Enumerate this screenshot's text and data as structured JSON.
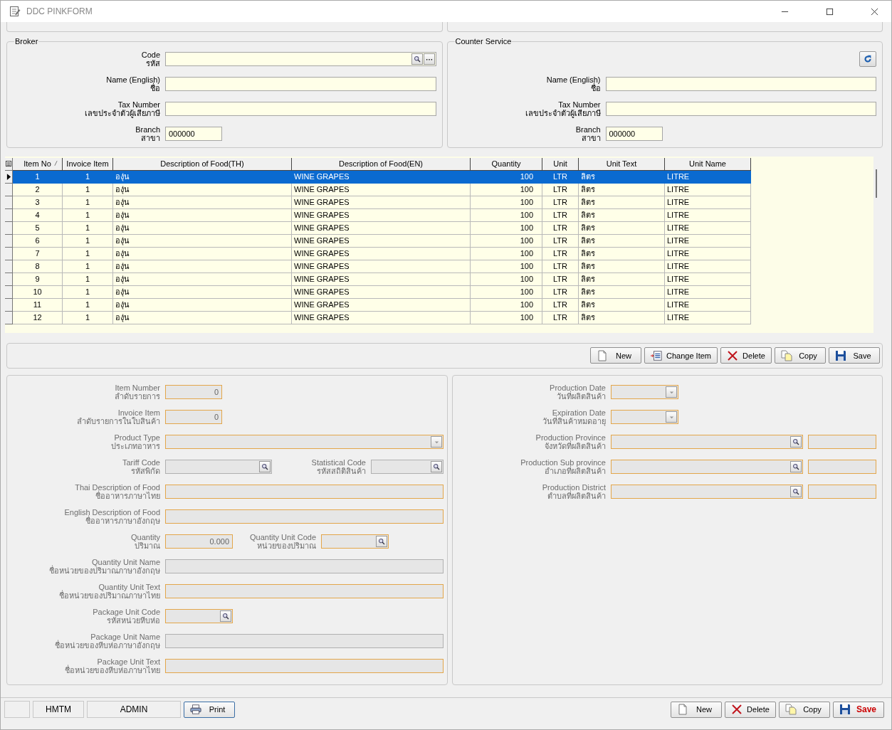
{
  "window": {
    "title": "DDC PINKFORM"
  },
  "broker": {
    "title": "Broker",
    "fields": [
      {
        "label": "Code",
        "label_th": "รหัส",
        "kind": "lookup"
      },
      {
        "label": "Name (English)",
        "label_th": "ชื่อ",
        "kind": "text"
      },
      {
        "label": "Tax Number",
        "label_th": "เลขประจำตัวผู้เสียภาษี",
        "kind": "text"
      },
      {
        "label": "Branch",
        "label_th": "สาขา",
        "kind": "text",
        "value": "000000"
      }
    ]
  },
  "counter_service": {
    "title": "Counter Service",
    "fields": [
      {
        "label": "Name (English)",
        "label_th": "ชื่อ",
        "kind": "text"
      },
      {
        "label": "Tax Number",
        "label_th": "เลขประจำตัวผู้เสียภาษี",
        "kind": "text"
      },
      {
        "label": "Branch",
        "label_th": "สาขา",
        "kind": "text",
        "value": "000000"
      }
    ]
  },
  "grid": {
    "columns": [
      {
        "label": "Item No",
        "sorted": true
      },
      {
        "label": "Invoice Item",
        "sorted": false
      },
      {
        "label": "Description of Food(TH)",
        "sorted": false
      },
      {
        "label": "Description of Food(EN)",
        "sorted": false
      },
      {
        "label": "Quantity",
        "sorted": false
      },
      {
        "label": "Unit",
        "sorted": false
      },
      {
        "label": "Unit Text",
        "sorted": false
      },
      {
        "label": "Unit Name",
        "sorted": false
      }
    ],
    "rows": [
      {
        "selected": true,
        "cells": [
          "1",
          "1",
          "องุ่น",
          "WINE GRAPES",
          "100",
          "LTR",
          "ลิตร",
          "LITRE"
        ]
      },
      {
        "selected": false,
        "cells": [
          "2",
          "1",
          "องุ่น",
          "WINE GRAPES",
          "100",
          "LTR",
          "ลิตร",
          "LITRE"
        ]
      },
      {
        "selected": false,
        "cells": [
          "3",
          "1",
          "องุ่น",
          "WINE GRAPES",
          "100",
          "LTR",
          "ลิตร",
          "LITRE"
        ]
      },
      {
        "selected": false,
        "cells": [
          "4",
          "1",
          "องุ่น",
          "WINE GRAPES",
          "100",
          "LTR",
          "ลิตร",
          "LITRE"
        ]
      },
      {
        "selected": false,
        "cells": [
          "5",
          "1",
          "องุ่น",
          "WINE GRAPES",
          "100",
          "LTR",
          "ลิตร",
          "LITRE"
        ]
      },
      {
        "selected": false,
        "cells": [
          "6",
          "1",
          "องุ่น",
          "WINE GRAPES",
          "100",
          "LTR",
          "ลิตร",
          "LITRE"
        ]
      },
      {
        "selected": false,
        "cells": [
          "7",
          "1",
          "องุ่น",
          "WINE GRAPES",
          "100",
          "LTR",
          "ลิตร",
          "LITRE"
        ]
      },
      {
        "selected": false,
        "cells": [
          "8",
          "1",
          "องุ่น",
          "WINE GRAPES",
          "100",
          "LTR",
          "ลิตร",
          "LITRE"
        ]
      },
      {
        "selected": false,
        "cells": [
          "9",
          "1",
          "องุ่น",
          "WINE GRAPES",
          "100",
          "LTR",
          "ลิตร",
          "LITRE"
        ]
      },
      {
        "selected": false,
        "cells": [
          "10",
          "1",
          "องุ่น",
          "WINE GRAPES",
          "100",
          "LTR",
          "ลิตร",
          "LITRE"
        ]
      },
      {
        "selected": false,
        "cells": [
          "11",
          "1",
          "องุ่น",
          "WINE GRAPES",
          "100",
          "LTR",
          "ลิตร",
          "LITRE"
        ]
      },
      {
        "selected": false,
        "cells": [
          "12",
          "1",
          "องุ่น",
          "WINE GRAPES",
          "100",
          "LTR",
          "ลิตร",
          "LITRE"
        ]
      }
    ]
  },
  "item_toolbar": {
    "buttons": [
      {
        "label": "New",
        "kind": "new"
      },
      {
        "label": "Change Item",
        "kind": "change"
      },
      {
        "label": "Delete",
        "kind": "delete"
      },
      {
        "label": "Copy",
        "kind": "copy"
      },
      {
        "label": "Save",
        "kind": "save"
      }
    ]
  },
  "item_detail": {
    "left": [
      {
        "fields": [
          {
            "label": "Item Number",
            "label_th": "ลำดับรายการ",
            "kind": "number",
            "value": "0",
            "required": true
          }
        ]
      },
      {
        "fields": [
          {
            "label": "Invoice Item",
            "label_th": "ลำดับรายการในใบสินค้า",
            "kind": "number",
            "value": "0",
            "required": true
          }
        ]
      },
      {
        "fields": [
          {
            "label": "Product Type",
            "label_th": "ประเภทอาหาร",
            "kind": "dropdown",
            "required": true
          }
        ]
      },
      {
        "fields": [
          {
            "label": "Tariff Code",
            "label_th": "รหัสพิกัด",
            "kind": "lookup",
            "required": false
          },
          {
            "label": "Statistical Code",
            "label_th": "รหัสสถิติสินค้า",
            "kind": "lookup",
            "required": false
          }
        ]
      },
      {
        "fields": [
          {
            "label": "Thai Description of Food",
            "label_th": "ชื่ออาหารภาษาไทย",
            "kind": "text",
            "required": true
          }
        ]
      },
      {
        "fields": [
          {
            "label": "English Description of Food",
            "label_th": "ชื่ออาหารภาษาอังกฤษ",
            "kind": "text",
            "required": true
          }
        ]
      },
      {
        "fields": [
          {
            "label": "Quantity",
            "label_th": "ปริมาณ",
            "kind": "number",
            "value": "0.000",
            "required": true
          },
          {
            "label": "Quantity Unit Code",
            "label_th": "หน่วยของปริมาณ",
            "kind": "lookup",
            "required": true
          }
        ]
      },
      {
        "fields": [
          {
            "label": "Quantity Unit Name",
            "label_th": "ชื่อหน่วยของปริมาณภาษาอังกฤษ",
            "kind": "text",
            "required": false
          }
        ]
      },
      {
        "fields": [
          {
            "label": "Quantity Unit Text",
            "label_th": "ชื่อหน่วยของปริมาณภาษาไทย",
            "kind": "text",
            "required": true
          }
        ]
      },
      {
        "fields": [
          {
            "label": "Package Unit Code",
            "label_th": "รหัสหน่วยหีบห่อ",
            "kind": "lookup",
            "required": true
          }
        ]
      },
      {
        "fields": [
          {
            "label": "Package Unit Name",
            "label_th": "ชื่อหน่วยของหีบห่อภาษาอังกฤษ",
            "kind": "text",
            "required": false
          }
        ]
      },
      {
        "fields": [
          {
            "label": "Package Unit Text",
            "label_th": "ชื่อหน่วยของหีบห่อภาษาไทย",
            "kind": "text",
            "required": true
          }
        ]
      }
    ],
    "right": [
      {
        "fields": [
          {
            "label": "Production Date",
            "label_th": "วันที่ผลิตสินค้า",
            "kind": "dropdown",
            "required": true
          }
        ]
      },
      {
        "fields": [
          {
            "label": "Expiration Date",
            "label_th": "วันที่สินค้าหมดอายุ",
            "kind": "dropdown",
            "required": true
          }
        ]
      },
      {
        "fields": [
          {
            "label": "Production Province",
            "label_th": "จังหวัดที่ผลิตสินค้า",
            "kind": "lookup",
            "required": true,
            "name_box": true
          }
        ]
      },
      {
        "fields": [
          {
            "label": "Production Sub province",
            "label_th": "อำเภอที่ผลิตสินค้า",
            "kind": "lookup",
            "required": true,
            "name_box": true
          }
        ]
      },
      {
        "fields": [
          {
            "label": "Production District",
            "label_th": "ตำบลที่ผลิตสินค้า",
            "kind": "lookup",
            "required": true,
            "name_box": true
          }
        ]
      }
    ]
  },
  "status_bar": {
    "cells": [
      "HMTM",
      "ADMIN"
    ],
    "print": "Print",
    "buttons": [
      {
        "label": "New",
        "kind": "new"
      },
      {
        "label": "Delete",
        "kind": "delete"
      },
      {
        "label": "Copy",
        "kind": "copy"
      },
      {
        "label": "Save",
        "kind": "save"
      }
    ]
  }
}
